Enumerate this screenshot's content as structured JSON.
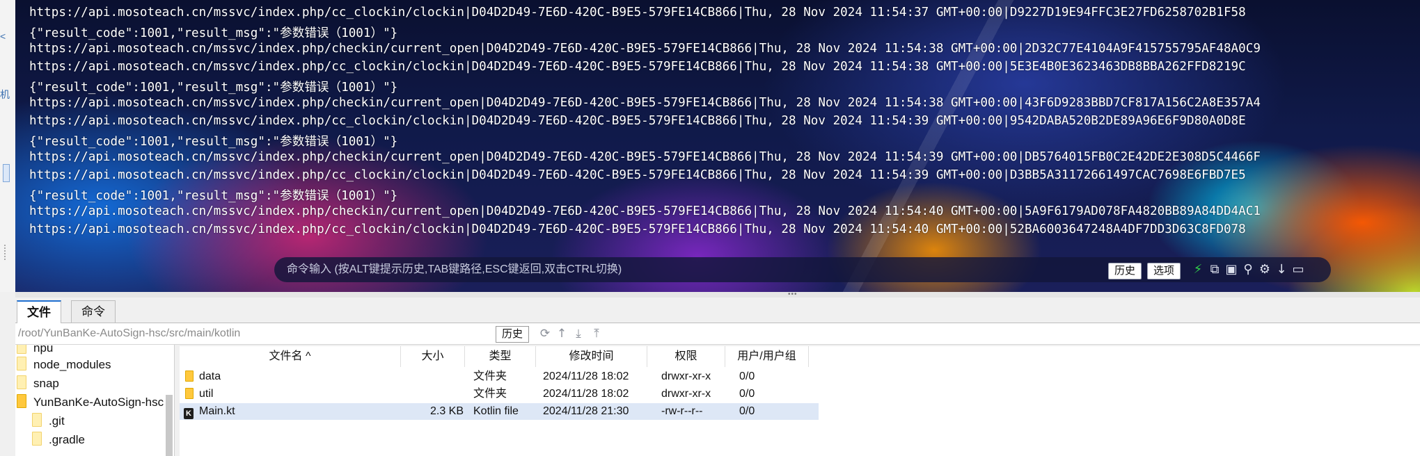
{
  "left_strip": {
    "chars": [
      "<",
      "机"
    ]
  },
  "terminal": {
    "lines": [
      "https://api.mosoteach.cn/mssvc/index.php/cc_clockin/clockin|D04D2D49-7E6D-420C-B9E5-579FE14CB866|Thu, 28 Nov 2024 11:54:37 GMT+00:00|D9227D19E94FFC3E27FD6258702B1F58",
      "{\"result_code\":1001,\"result_msg\":\"参数错误（1001）\"}",
      "https://api.mosoteach.cn/mssvc/index.php/checkin/current_open|D04D2D49-7E6D-420C-B9E5-579FE14CB866|Thu, 28 Nov 2024 11:54:38 GMT+00:00|2D32C77E4104A9F415755795AF48A0C9",
      "https://api.mosoteach.cn/mssvc/index.php/cc_clockin/clockin|D04D2D49-7E6D-420C-B9E5-579FE14CB866|Thu, 28 Nov 2024 11:54:38 GMT+00:00|5E3E4B0E3623463DB8BBA262FFD8219C",
      "{\"result_code\":1001,\"result_msg\":\"参数错误（1001）\"}",
      "https://api.mosoteach.cn/mssvc/index.php/checkin/current_open|D04D2D49-7E6D-420C-B9E5-579FE14CB866|Thu, 28 Nov 2024 11:54:38 GMT+00:00|43F6D9283BBD7CF817A156C2A8E357A4",
      "https://api.mosoteach.cn/mssvc/index.php/cc_clockin/clockin|D04D2D49-7E6D-420C-B9E5-579FE14CB866|Thu, 28 Nov 2024 11:54:39 GMT+00:00|9542DABA520B2DE89A96E6F9D80A0D8E",
      "{\"result_code\":1001,\"result_msg\":\"参数错误（1001）\"}",
      "https://api.mosoteach.cn/mssvc/index.php/checkin/current_open|D04D2D49-7E6D-420C-B9E5-579FE14CB866|Thu, 28 Nov 2024 11:54:39 GMT+00:00|DB5764015FB0C2E42DE2E308D5C4466F",
      "https://api.mosoteach.cn/mssvc/index.php/cc_clockin/clockin|D04D2D49-7E6D-420C-B9E5-579FE14CB866|Thu, 28 Nov 2024 11:54:39 GMT+00:00|D3BB5A31172661497CAC7698E6FBD7E5",
      "{\"result_code\":1001,\"result_msg\":\"参数错误（1001）\"}",
      "https://api.mosoteach.cn/mssvc/index.php/checkin/current_open|D04D2D49-7E6D-420C-B9E5-579FE14CB866|Thu, 28 Nov 2024 11:54:40 GMT+00:00|5A9F6179AD078FA4820BB89A84DD4AC1",
      "https://api.mosoteach.cn/mssvc/index.php/cc_clockin/clockin|D04D2D49-7E6D-420C-B9E5-579FE14CB866|Thu, 28 Nov 2024 11:54:40 GMT+00:00|52BA6003647248A4DF7DD3D63C8FD078"
    ],
    "command_placeholder": "命令输入 (按ALT键提示历史,TAB键路径,ESC键返回,双击CTRL切换)",
    "history_btn": "历史",
    "options_btn": "选项",
    "icons": [
      "lightning-icon",
      "copy-icon",
      "paste-icon",
      "search-icon",
      "gear-icon",
      "arrow-down-icon",
      "window-icon"
    ]
  },
  "tabs": [
    {
      "label": "文件",
      "active": true
    },
    {
      "label": "命令",
      "active": false
    }
  ],
  "path": {
    "value": "/root/YunBanKe-AutoSign-hsc/src/main/kotlin",
    "history_btn": "历史",
    "icons": [
      "refresh-icon",
      "up-icon",
      "download-icon",
      "upload-icon"
    ]
  },
  "tree": {
    "items": [
      {
        "label": "npu",
        "indent": 0
      },
      {
        "label": "node_modules",
        "indent": 0
      },
      {
        "label": "snap",
        "indent": 0
      },
      {
        "label": "YunBanKe-AutoSign-hsc",
        "indent": 0
      },
      {
        "label": ".git",
        "indent": 1
      },
      {
        "label": ".gradle",
        "indent": 1
      }
    ]
  },
  "filelist": {
    "headers": [
      "文件名 ^",
      "大小",
      "类型",
      "修改时间",
      "权限",
      "用户/用户组"
    ],
    "rows": [
      {
        "name": "data",
        "size": "",
        "type": "文件夹",
        "mtime": "2024/11/28 18:02",
        "perm": "drwxr-xr-x",
        "owner": "0/0",
        "kind": "folder"
      },
      {
        "name": "util",
        "size": "",
        "type": "文件夹",
        "mtime": "2024/11/28 18:02",
        "perm": "drwxr-xr-x",
        "owner": "0/0",
        "kind": "folder"
      },
      {
        "name": "Main.kt",
        "size": "2.3 KB",
        "type": "Kotlin file",
        "mtime": "2024/11/28 21:30",
        "perm": "-rw-r--r--",
        "owner": "0/0",
        "kind": "kotlin"
      }
    ]
  }
}
